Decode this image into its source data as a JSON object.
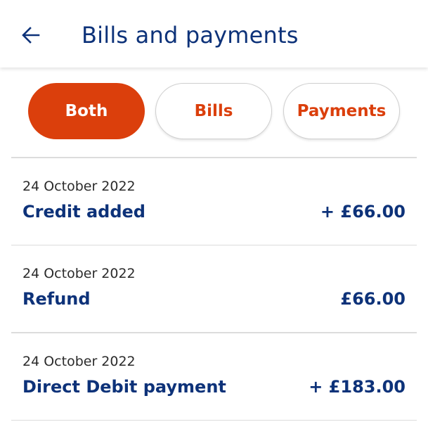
{
  "header": {
    "title": "Bills and payments",
    "back_icon": "arrow-left-icon"
  },
  "filters": {
    "both": "Both",
    "bills": "Bills",
    "payments": "Payments",
    "selected": "Both"
  },
  "transactions": [
    {
      "date": "24 October 2022",
      "title": "Credit added",
      "amount": "+ £66.00"
    },
    {
      "date": "24 October 2022",
      "title": "Refund",
      "amount": "£66.00"
    },
    {
      "date": "24 October 2022",
      "title": "Direct Debit payment",
      "amount": "+ £183.00"
    }
  ],
  "colors": {
    "brand_navy": "#0d3279",
    "accent_orange": "#db3f0c",
    "divider": "#dcdcdc",
    "text_secondary": "#2b2b2b"
  }
}
